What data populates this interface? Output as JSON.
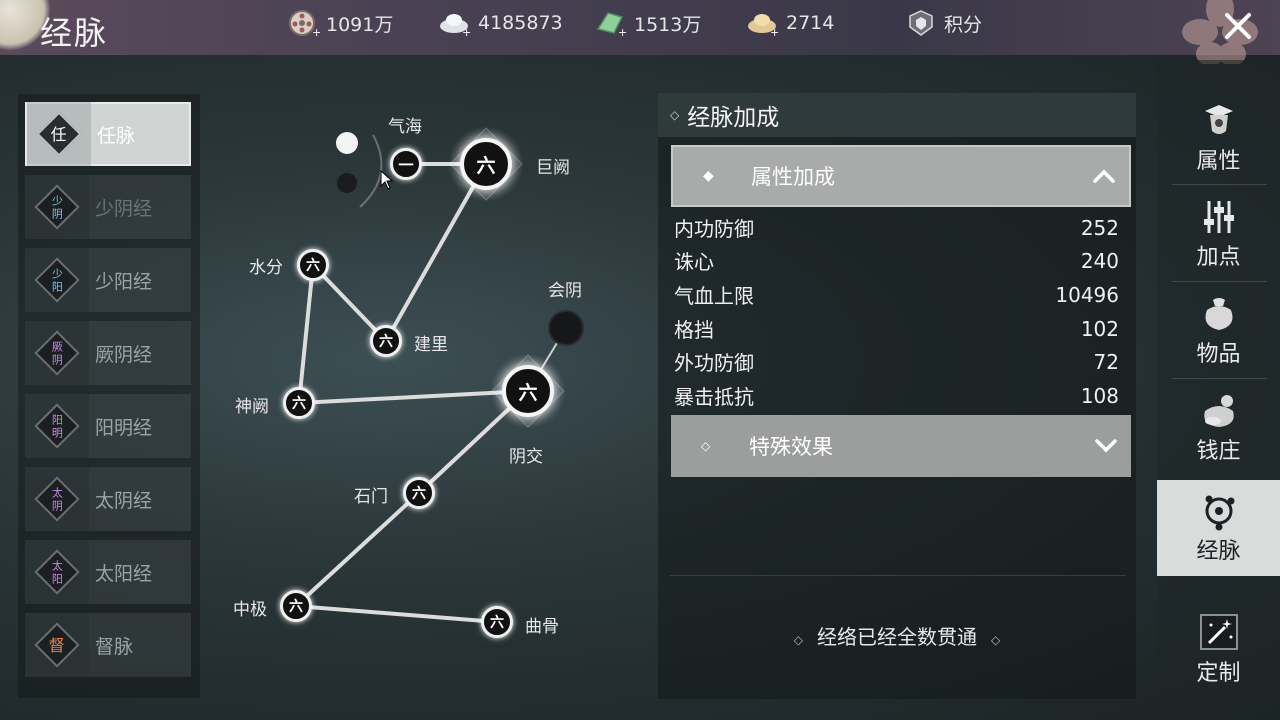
{
  "window": {
    "title": "经脉",
    "close_icon": "close-icon"
  },
  "currencies": [
    {
      "icon": "film-reel-icon",
      "value": "1091万"
    },
    {
      "icon": "silver-ingot-icon",
      "value": "4185873"
    },
    {
      "icon": "jade-icon",
      "value": "1513万"
    },
    {
      "icon": "gold-ingot-icon",
      "value": "2714"
    },
    {
      "icon": "badge-icon",
      "value": "积分"
    }
  ],
  "meridians": [
    {
      "glyph": "任",
      "label": "任脉",
      "active": true,
      "color": "#ffffff"
    },
    {
      "glyph": "少\n阴",
      "label": "少阴经",
      "active": false,
      "color": "#7fc0e6"
    },
    {
      "glyph": "少\n阳",
      "label": "少阳经",
      "active": false,
      "color": "#7fc0e6"
    },
    {
      "glyph": "厥\n阴",
      "label": "厥阴经",
      "active": false,
      "color": "#c48be0"
    },
    {
      "glyph": "阳\n明",
      "label": "阳明经",
      "active": false,
      "color": "#c48be0"
    },
    {
      "glyph": "太\n阴",
      "label": "太阴经",
      "active": false,
      "color": "#c48be0"
    },
    {
      "glyph": "太\n阳",
      "label": "太阳经",
      "active": false,
      "color": "#c48be0"
    },
    {
      "glyph": "督",
      "label": "督脉",
      "active": false,
      "color": "#e9864a"
    }
  ],
  "acupoints": {
    "qihai": {
      "label": "气海",
      "level": "一"
    },
    "juque": {
      "label": "巨阙",
      "level": "六"
    },
    "shuifen": {
      "label": "水分",
      "level": "六"
    },
    "jianli": {
      "label": "建里",
      "level": "六"
    },
    "huiyin": {
      "label": "会阴",
      "level": ""
    },
    "shenque": {
      "label": "神阙",
      "level": "六"
    },
    "yinjiao": {
      "label": "阴交",
      "level": "六"
    },
    "shimen": {
      "label": "石门",
      "level": "六"
    },
    "zhongji": {
      "label": "中极",
      "level": "六"
    },
    "qugu": {
      "label": "曲骨",
      "level": "六"
    }
  },
  "detail": {
    "title": "经脉加成",
    "attributes_section": "属性加成",
    "stats": [
      {
        "name": "内功防御",
        "value": "252"
      },
      {
        "name": "诛心",
        "value": "240"
      },
      {
        "name": "气血上限",
        "value": "10496"
      },
      {
        "name": "格挡",
        "value": "102"
      },
      {
        "name": "外功防御",
        "value": "72"
      },
      {
        "name": "暴击抵抗",
        "value": "108"
      }
    ],
    "special_section": "特殊效果",
    "footer": "经络已经全数贯通"
  },
  "tabs": [
    {
      "icon": "attribute-icon",
      "label": "属性",
      "active": false
    },
    {
      "icon": "sliders-icon",
      "label": "加点",
      "active": false
    },
    {
      "icon": "bag-icon",
      "label": "物品",
      "active": false
    },
    {
      "icon": "money-bag-icon",
      "label": "钱庄",
      "active": false
    },
    {
      "icon": "meridian-icon",
      "label": "经脉",
      "active": true
    },
    {
      "icon": "magic-wand-icon",
      "label": "定制",
      "active": false
    }
  ]
}
